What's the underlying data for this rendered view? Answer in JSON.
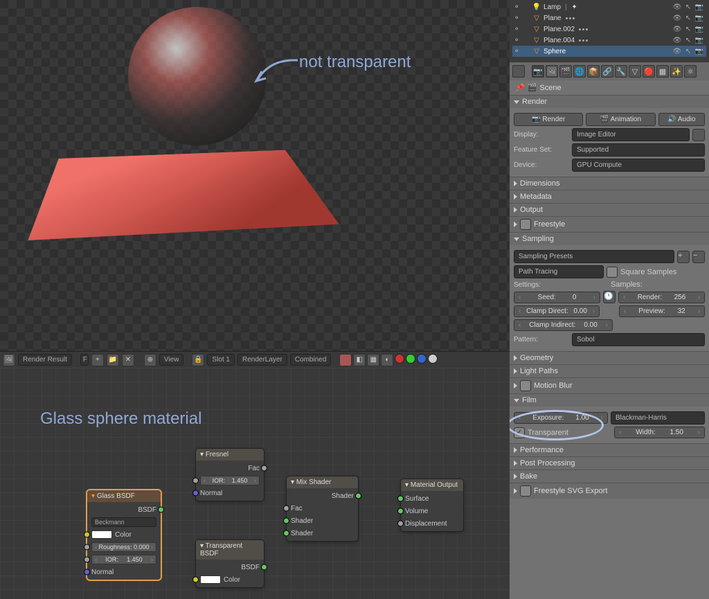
{
  "annotations": {
    "not_transparent": "not transparent",
    "glass_material": "Glass sphere material"
  },
  "outliner": {
    "items": [
      {
        "expand": "⚬",
        "icon": "lamp",
        "name": "Lamp"
      },
      {
        "expand": "⚬",
        "icon": "mesh",
        "name": "Plane"
      },
      {
        "expand": "⚬",
        "icon": "mesh",
        "name": "Plane.002"
      },
      {
        "expand": "⚬",
        "icon": "mesh",
        "name": "Plane.004"
      },
      {
        "expand": "⚬",
        "icon": "mesh",
        "name": "Sphere",
        "selected": true
      }
    ]
  },
  "breadcrumb": "Scene",
  "panels": {
    "render": {
      "title": "Render",
      "buttons": {
        "render": "Render",
        "animation": "Animation",
        "audio": "Audio"
      },
      "display_label": "Display:",
      "display_value": "Image Editor",
      "feature_label": "Feature Set:",
      "feature_value": "Supported",
      "device_label": "Device:",
      "device_value": "GPU Compute"
    },
    "dimensions": "Dimensions",
    "metadata": "Metadata",
    "output": "Output",
    "freestyle": "Freestyle",
    "sampling": {
      "title": "Sampling",
      "presets": "Sampling Presets",
      "integrator": "Path Tracing",
      "square": "Square Samples",
      "settings_label": "Settings:",
      "samples_label": "Samples:",
      "seed_label": "Seed:",
      "seed_value": "0",
      "render_label": "Render:",
      "render_value": "256",
      "clamp_direct_label": "Clamp Direct:",
      "clamp_direct_value": "0.00",
      "preview_label": "Preview:",
      "preview_value": "32",
      "clamp_indirect_label": "Clamp Indirect:",
      "clamp_indirect_value": "0.00",
      "pattern_label": "Pattern:",
      "pattern_value": "Sobol"
    },
    "geometry": "Geometry",
    "light_paths": "Light Paths",
    "motion_blur": "Motion Blur",
    "film": {
      "title": "Film",
      "exposure_label": "Exposure:",
      "exposure_value": "1.00",
      "filter": "Blackman-Harris",
      "transparent": "Transparent",
      "width_label": "Width:",
      "width_value": "1.50"
    },
    "performance": "Performance",
    "post": "Post Processing",
    "bake": "Bake",
    "freestyle_svg": "Freestyle SVG Export"
  },
  "header": {
    "render_result": "Render Result",
    "view": "View",
    "slot": "Slot 1",
    "layer": "RenderLayer",
    "pass": "Combined"
  },
  "nodes": {
    "glass": {
      "title": "Glass BSDF",
      "out_bsdf": "BSDF",
      "distribution": "Beckmann",
      "color": "Color",
      "roughness_label": "Roughness:",
      "roughness_value": "0.000",
      "ior_label": "IOR:",
      "ior_value": "1.450",
      "normal": "Normal"
    },
    "fresnel": {
      "title": "Fresnel",
      "out_fac": "Fac",
      "ior_label": "IOR:",
      "ior_value": "1.450",
      "normal": "Normal"
    },
    "transparent": {
      "title": "Transparent BSDF",
      "out_bsdf": "BSDF",
      "color": "Color"
    },
    "mix": {
      "title": "Mix Shader",
      "out_shader": "Shader",
      "fac": "Fac",
      "shader1": "Shader",
      "shader2": "Shader"
    },
    "output": {
      "title": "Material Output",
      "surface": "Surface",
      "volume": "Volume",
      "displacement": "Displacement"
    }
  }
}
